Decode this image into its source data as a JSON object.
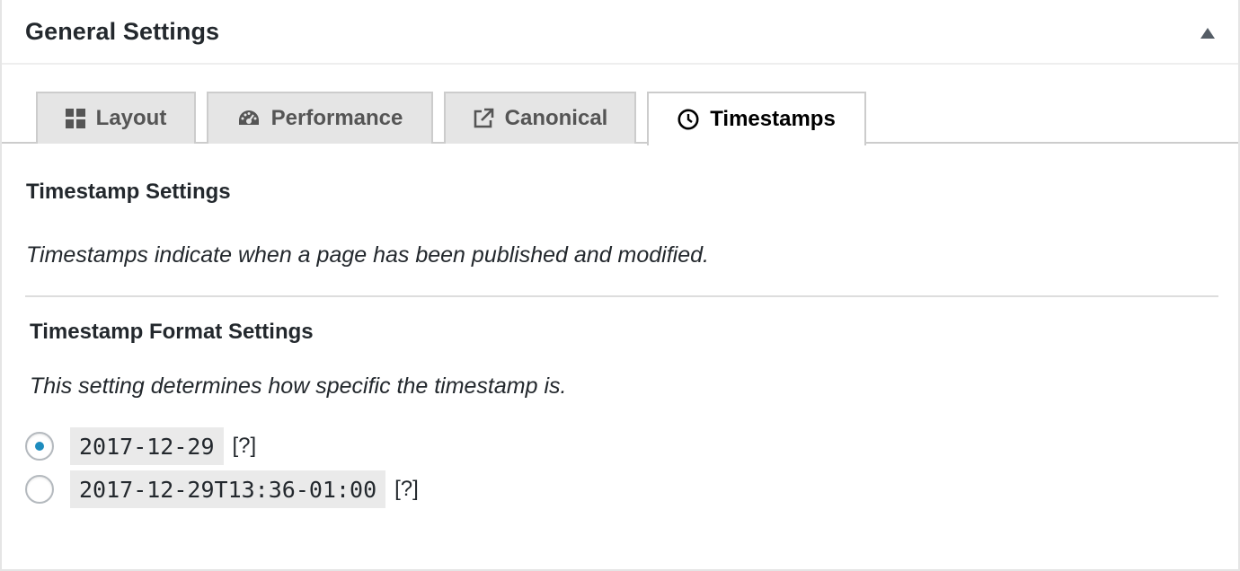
{
  "header": {
    "title": "General Settings",
    "toggle_icon": "triangle-up-icon"
  },
  "tabs": [
    {
      "label": "Layout",
      "icon": "grid-icon",
      "active": false
    },
    {
      "label": "Performance",
      "icon": "dashboard-icon",
      "active": false
    },
    {
      "label": "Canonical",
      "icon": "external-link-icon",
      "active": false
    },
    {
      "label": "Timestamps",
      "icon": "clock-icon",
      "active": true
    }
  ],
  "panel": {
    "title": "Timestamp Settings",
    "description": "Timestamps indicate when a page has been published and modified.",
    "format": {
      "title": "Timestamp Format Settings",
      "description": "This setting determines how specific the timestamp is.",
      "options": [
        {
          "value": "2017-12-29",
          "help": "[?]",
          "checked": true
        },
        {
          "value": "2017-12-29T13:36-01:00",
          "help": "[?]",
          "checked": false
        }
      ]
    }
  },
  "colors": {
    "radio_checked": "#1e8cbe",
    "border": "#cccccc",
    "tab_inactive_bg": "#e5e5e5"
  }
}
